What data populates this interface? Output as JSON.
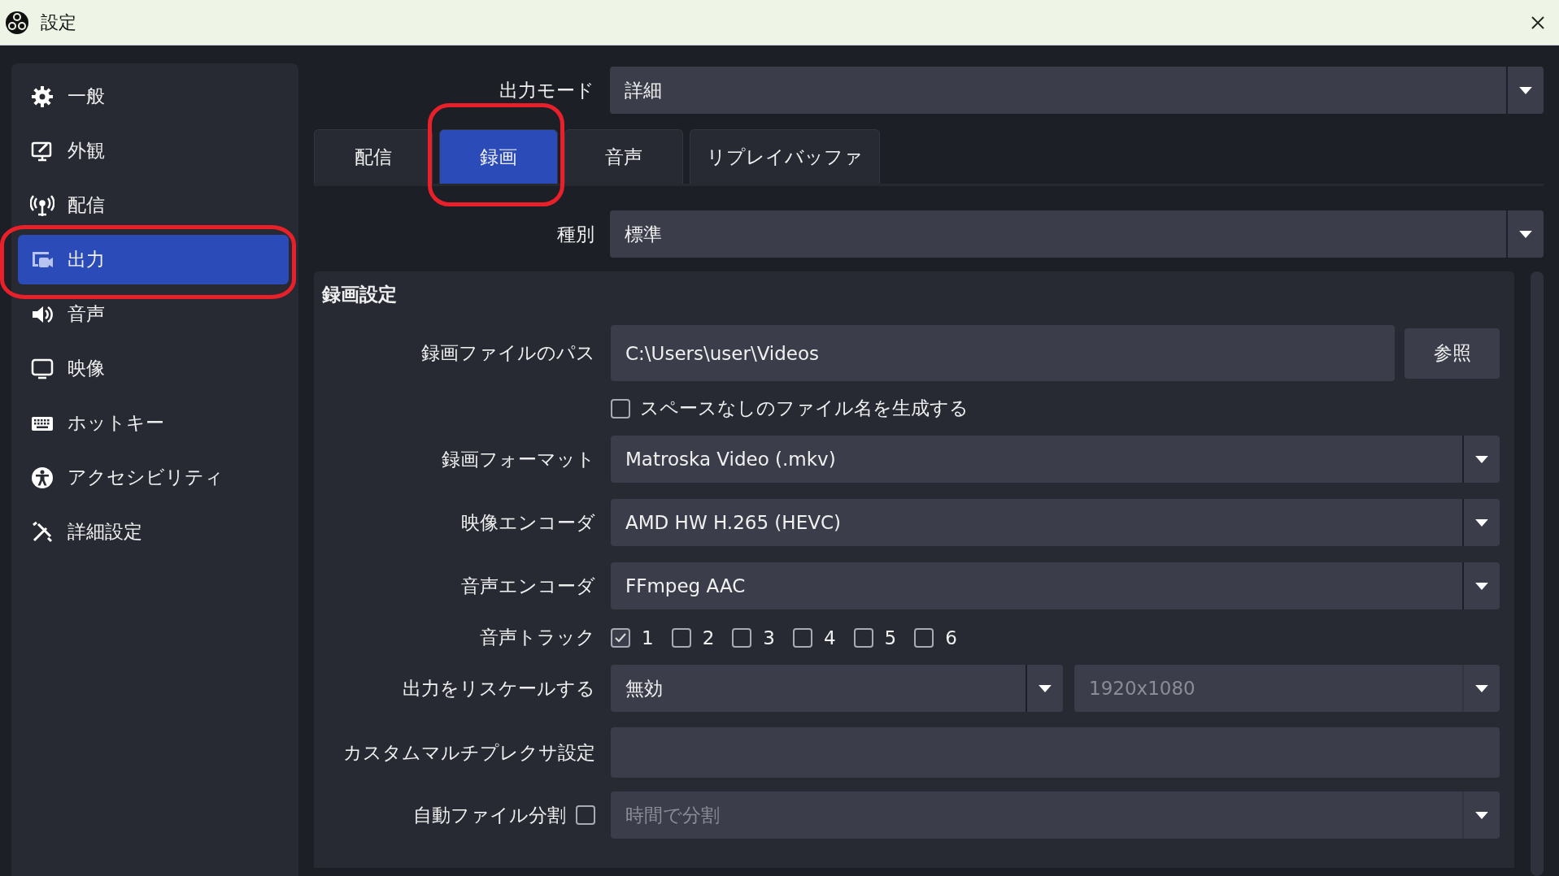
{
  "window": {
    "title": "設定"
  },
  "sidebar": {
    "items": [
      {
        "label": "一般",
        "selected": false,
        "highlighted": false
      },
      {
        "label": "外観",
        "selected": false,
        "highlighted": false
      },
      {
        "label": "配信",
        "selected": false,
        "highlighted": false
      },
      {
        "label": "出力",
        "selected": true,
        "highlighted": true
      },
      {
        "label": "音声",
        "selected": false,
        "highlighted": false
      },
      {
        "label": "映像",
        "selected": false,
        "highlighted": false
      },
      {
        "label": "ホットキー",
        "selected": false,
        "highlighted": false
      },
      {
        "label": "アクセシビリティ",
        "selected": false,
        "highlighted": false
      },
      {
        "label": "詳細設定",
        "selected": false,
        "highlighted": false
      }
    ]
  },
  "output_mode": {
    "label": "出力モード",
    "value": "詳細"
  },
  "tabs": [
    {
      "label": "配信",
      "selected": false,
      "highlighted": false
    },
    {
      "label": "録画",
      "selected": true,
      "highlighted": true
    },
    {
      "label": "音声",
      "selected": false,
      "highlighted": false
    },
    {
      "label": "リプレイバッファ",
      "selected": false,
      "highlighted": false
    }
  ],
  "type": {
    "label": "種別",
    "value": "標準"
  },
  "recording_settings": {
    "title": "録画設定",
    "rows": [
      {
        "kind": "path",
        "label": "録画ファイルのパス",
        "value": "C:\\Users\\user\\Videos",
        "button": "参照"
      },
      {
        "kind": "checkbox",
        "label": "スペースなしのファイル名を生成する",
        "checked": false
      },
      {
        "kind": "select",
        "label": "録画フォーマット",
        "value": "Matroska Video (.mkv)"
      },
      {
        "kind": "select",
        "label": "映像エンコーダ",
        "value": "AMD HW H.265 (HEVC)"
      },
      {
        "kind": "select",
        "label": "音声エンコーダ",
        "value": "FFmpeg AAC"
      },
      {
        "kind": "tracks",
        "label": "音声トラック",
        "tracks": [
          {
            "label": "1",
            "checked": true
          },
          {
            "label": "2",
            "checked": false
          },
          {
            "label": "3",
            "checked": false
          },
          {
            "label": "4",
            "checked": false
          },
          {
            "label": "5",
            "checked": false
          },
          {
            "label": "6",
            "checked": false
          }
        ]
      },
      {
        "kind": "rescale",
        "label": "出力をリスケールする",
        "value": "無効",
        "resolution": "1920x1080",
        "resolution_disabled": true
      },
      {
        "kind": "text",
        "label": "カスタムマルチプレクサ設定"
      },
      {
        "kind": "split",
        "label": "自動ファイル分割",
        "checked": false,
        "value": "時間で分割",
        "disabled": true
      }
    ]
  }
}
